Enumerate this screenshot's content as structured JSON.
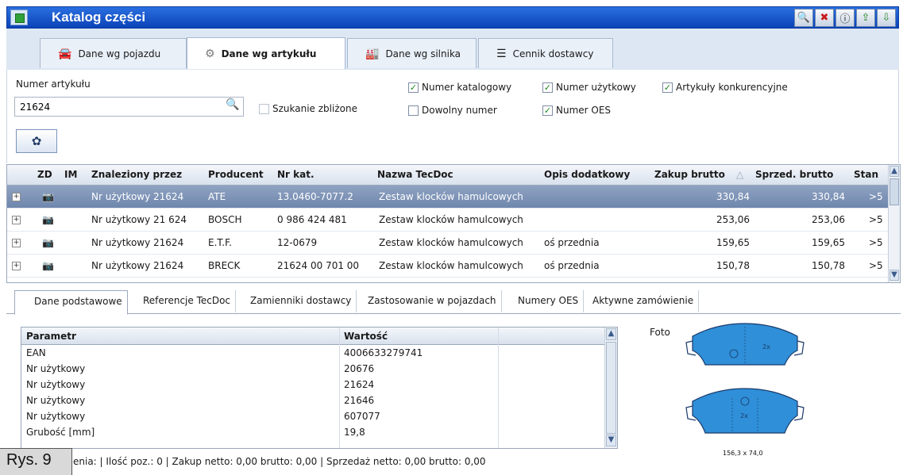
{
  "window": {
    "title": "Katalog części"
  },
  "toolbar": {
    "buttons": [
      "search-icon",
      "delete-icon",
      "info-icon",
      "export-icon",
      "import-icon"
    ]
  },
  "top_tabs": [
    {
      "label": "Dane wg pojazdu",
      "icon": "car-icon",
      "active": false
    },
    {
      "label": "Dane wg artykułu",
      "icon": "gear-icon",
      "active": true
    },
    {
      "label": "Dane wg silnika",
      "icon": "engine-icon",
      "active": false
    },
    {
      "label": "Cennik dostawcy",
      "icon": "list-icon",
      "active": false
    }
  ],
  "search": {
    "label": "Numer artykułu",
    "value": "21624",
    "approx_label": "Szukanie zbliżone",
    "approx_checked": false
  },
  "options": [
    {
      "label": "Numer katalogowy",
      "checked": true
    },
    {
      "label": "Dowolny numer",
      "checked": false
    },
    {
      "label": "Numer użytkowy",
      "checked": true
    },
    {
      "label": "Numer OES",
      "checked": true
    },
    {
      "label": "Artykuły konkurencyjne",
      "checked": true
    }
  ],
  "grid": {
    "columns": [
      "ZD",
      "IM",
      "Znaleziony przez",
      "Producent",
      "Nr kat.",
      "Nazwa TecDoc",
      "Opis dodatkowy",
      "Zakup brutto",
      "Sprzed. brutto",
      "Stan"
    ],
    "rows": [
      {
        "found_by": "Nr użytkowy 21624",
        "producer": "ATE",
        "cat_no": "13.0460-7077.2",
        "name": "Zestaw klocków hamulcowych",
        "desc": "",
        "buy": "330,84",
        "sell": "330,84",
        "stock": ">5",
        "selected": true
      },
      {
        "found_by": "Nr użytkowy 21 624",
        "producer": "BOSCH",
        "cat_no": "0 986 424 481",
        "name": "Zestaw klocków hamulcowych",
        "desc": "",
        "buy": "253,06",
        "sell": "253,06",
        "stock": ">5",
        "selected": false
      },
      {
        "found_by": "Nr użytkowy 21624",
        "producer": "E.T.F.",
        "cat_no": "12-0679",
        "name": "Zestaw klocków hamulcowych",
        "desc": "oś przednia",
        "buy": "159,65",
        "sell": "159,65",
        "stock": ">5",
        "selected": false
      },
      {
        "found_by": "Nr użytkowy 21624",
        "producer": "BRECK",
        "cat_no": "21624 00 701 00",
        "name": "Zestaw klocków hamulcowych",
        "desc": "oś przednia",
        "buy": "150,78",
        "sell": "150,78",
        "stock": ">5",
        "selected": false
      }
    ]
  },
  "bottom_tabs": [
    "Dane podstawowe",
    "Referencje TecDoc",
    "Zamienniki dostawcy",
    "Zastosowanie w pojazdach",
    "Numery OES",
    "Aktywne zamówienie"
  ],
  "params": {
    "columns": [
      "Parametr",
      "Wartość"
    ],
    "rows": [
      {
        "name": "EAN",
        "value": "4006633279741"
      },
      {
        "name": "Nr użytkowy",
        "value": "20676"
      },
      {
        "name": "Nr użytkowy",
        "value": "21624"
      },
      {
        "name": "Nr użytkowy",
        "value": "21646"
      },
      {
        "name": "Nr użytkowy",
        "value": "607077"
      },
      {
        "name": "Grubość [mm]",
        "value": "19,8"
      }
    ]
  },
  "foto": {
    "label": "Foto",
    "pad_label": "2x",
    "dimension": "156,3 x 74,0"
  },
  "status": {
    "text": "enia:  | Ilość poz.: 0  | Zakup netto: 0,00  brutto: 0,00  | Sprzedaż netto: 0,00  brutto: 0,00"
  },
  "figure_label": "Rys. 9",
  "colors": {
    "title_bar": "#0b43b8",
    "selected_row": "#7f95b8",
    "pad_fill": "#2f8fd8"
  }
}
